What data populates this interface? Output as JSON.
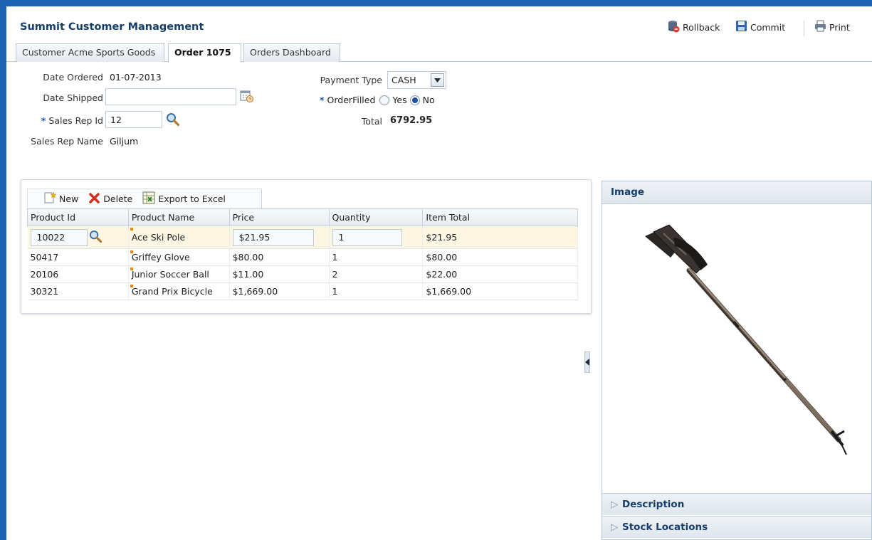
{
  "app": {
    "title": "Summit Customer Management"
  },
  "header": {
    "rollback_label": "Rollback",
    "commit_label": "Commit",
    "print_label": "Print"
  },
  "tabs": [
    {
      "label": "Customer Acme Sports Goods"
    },
    {
      "label": "Order 1075",
      "active": true
    },
    {
      "label": "Orders Dashboard"
    }
  ],
  "form": {
    "date_ordered_label": "Date Ordered",
    "date_ordered_value": "01-07-2013",
    "date_shipped_label": "Date Shipped",
    "date_shipped_value": "",
    "required_marker": "*",
    "sales_rep_id_label": "Sales Rep Id",
    "sales_rep_id_value": "12",
    "sales_rep_name_label": "Sales Rep Name",
    "sales_rep_name_value": "Giljum",
    "payment_type_label": "Payment Type",
    "payment_type_value": "CASH",
    "order_filled_label": "OrderFilled",
    "order_filled_options": [
      "Yes",
      "No"
    ],
    "order_filled_selected": "No",
    "total_label": "Total",
    "total_value": "6792.95"
  },
  "toolbar": {
    "new_label": "New",
    "delete_label": "Delete",
    "export_label": "Export to Excel"
  },
  "table": {
    "columns": [
      "Product Id",
      "Product Name",
      "Price",
      "Quantity",
      "Item Total"
    ],
    "rows": [
      {
        "product_id": "10022",
        "product_name": "Ace Ski Pole",
        "price": "$21.95",
        "quantity": "1",
        "item_total": "$21.95"
      },
      {
        "product_id": "50417",
        "product_name": "Griffey Glove",
        "price": "$80.00",
        "quantity": "1",
        "item_total": "$80.00"
      },
      {
        "product_id": "20106",
        "product_name": "Junior Soccer Ball",
        "price": "$11.00",
        "quantity": "2",
        "item_total": "$22.00"
      },
      {
        "product_id": "30321",
        "product_name": "Grand Prix Bicycle",
        "price": "$1,669.00",
        "quantity": "1",
        "item_total": "$1,669.00"
      }
    ]
  },
  "side_panel": {
    "image_header": "Image",
    "image_subject": "ski-pole",
    "accordions": [
      "Description",
      "Stock Locations"
    ]
  },
  "colors": {
    "frame": "#1c63b3",
    "title": "#163e6b",
    "selected_row": "#fdf6e3"
  }
}
